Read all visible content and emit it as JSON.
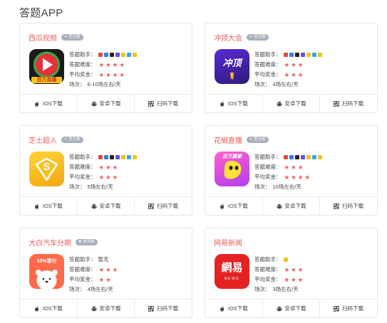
{
  "page_title": "答题APP",
  "labels": {
    "helper": "答题助手：",
    "difficulty": "答题难度：",
    "prize": "平均奖金：",
    "sessions": "场次："
  },
  "download": {
    "ios": "IOS下载",
    "android": "安卓下载",
    "qr": "扫码下载"
  },
  "icons": [
    "apple-icon",
    "android-icon",
    "qr-code-icon",
    "check-icon",
    "star-icon"
  ],
  "colors": {
    "accent": "#f05a5a",
    "badge": "#a8b0bb",
    "border": "#e6e6e6"
  },
  "apps": [
    {
      "name": "西瓜视频",
      "badge": "✔ 官方版",
      "logo_label": "百万英雄",
      "helper_colors": [
        "#e8483a",
        "#3a7be8",
        "#222",
        "#6b4de0",
        "#f0c419",
        "#35a7f0",
        "#f0c419"
      ],
      "helper_text": "",
      "difficulty_stars": 4,
      "prize_stars": 4,
      "difficulty": "★★★★",
      "prize": "★★★★",
      "sessions": "6-10场左右/天"
    },
    {
      "name": "冲顶大会",
      "badge": "✔ 官方版",
      "logo_label": "冲顶",
      "helper_colors": [
        "#e8483a",
        "#3a7be8",
        "#222",
        "#6b4de0",
        "#f0c419",
        "#35a7f0",
        "#f0c419"
      ],
      "helper_text": "",
      "difficulty_stars": 3,
      "prize_stars": 3,
      "difficulty": "★★★",
      "prize": "★★★",
      "sessions": "4场左右/天"
    },
    {
      "name": "芝士超人",
      "badge": "✔ 官方版",
      "logo_label": "S",
      "helper_colors": [
        "#e8483a",
        "#3a7be8",
        "#222",
        "#6b4de0",
        "#f0c419",
        "#35a7f0",
        "#f0c419"
      ],
      "helper_text": "",
      "difficulty_stars": 3,
      "prize_stars": 3,
      "difficulty": "★★★",
      "prize": "★★★",
      "sessions": "5场左右/天"
    },
    {
      "name": "花椒直播",
      "badge": "✔ 官方版",
      "logo_label": "百万赢家",
      "helper_colors": [
        "#e8483a",
        "#3a7be8",
        "#222",
        "#6b4de0",
        "#f0c419",
        "#35a7f0",
        "#f0c419"
      ],
      "helper_text": "",
      "difficulty_stars": 3,
      "prize_stars": 4,
      "difficulty": "★★★",
      "prize": "★★★★",
      "sessions": "10场左右/天"
    },
    {
      "name": "大白汽车分期",
      "badge": "✖ 未安装",
      "logo_label": "10%冒付",
      "helper_colors": [],
      "helper_text": "暂无",
      "difficulty_stars": 3,
      "prize_stars": 2,
      "difficulty": "★★★",
      "prize": "★★",
      "sessions": "4场左右/天"
    },
    {
      "name": "网易新闻",
      "badge": "",
      "logo_label": "網易",
      "logo_sub": "NEWS",
      "helper_colors": [
        "#f0c419"
      ],
      "helper_text": "",
      "difficulty_stars": 3,
      "prize_stars": 3,
      "difficulty": "★★★",
      "prize": "★★★",
      "sessions": "3场左右/天"
    }
  ]
}
